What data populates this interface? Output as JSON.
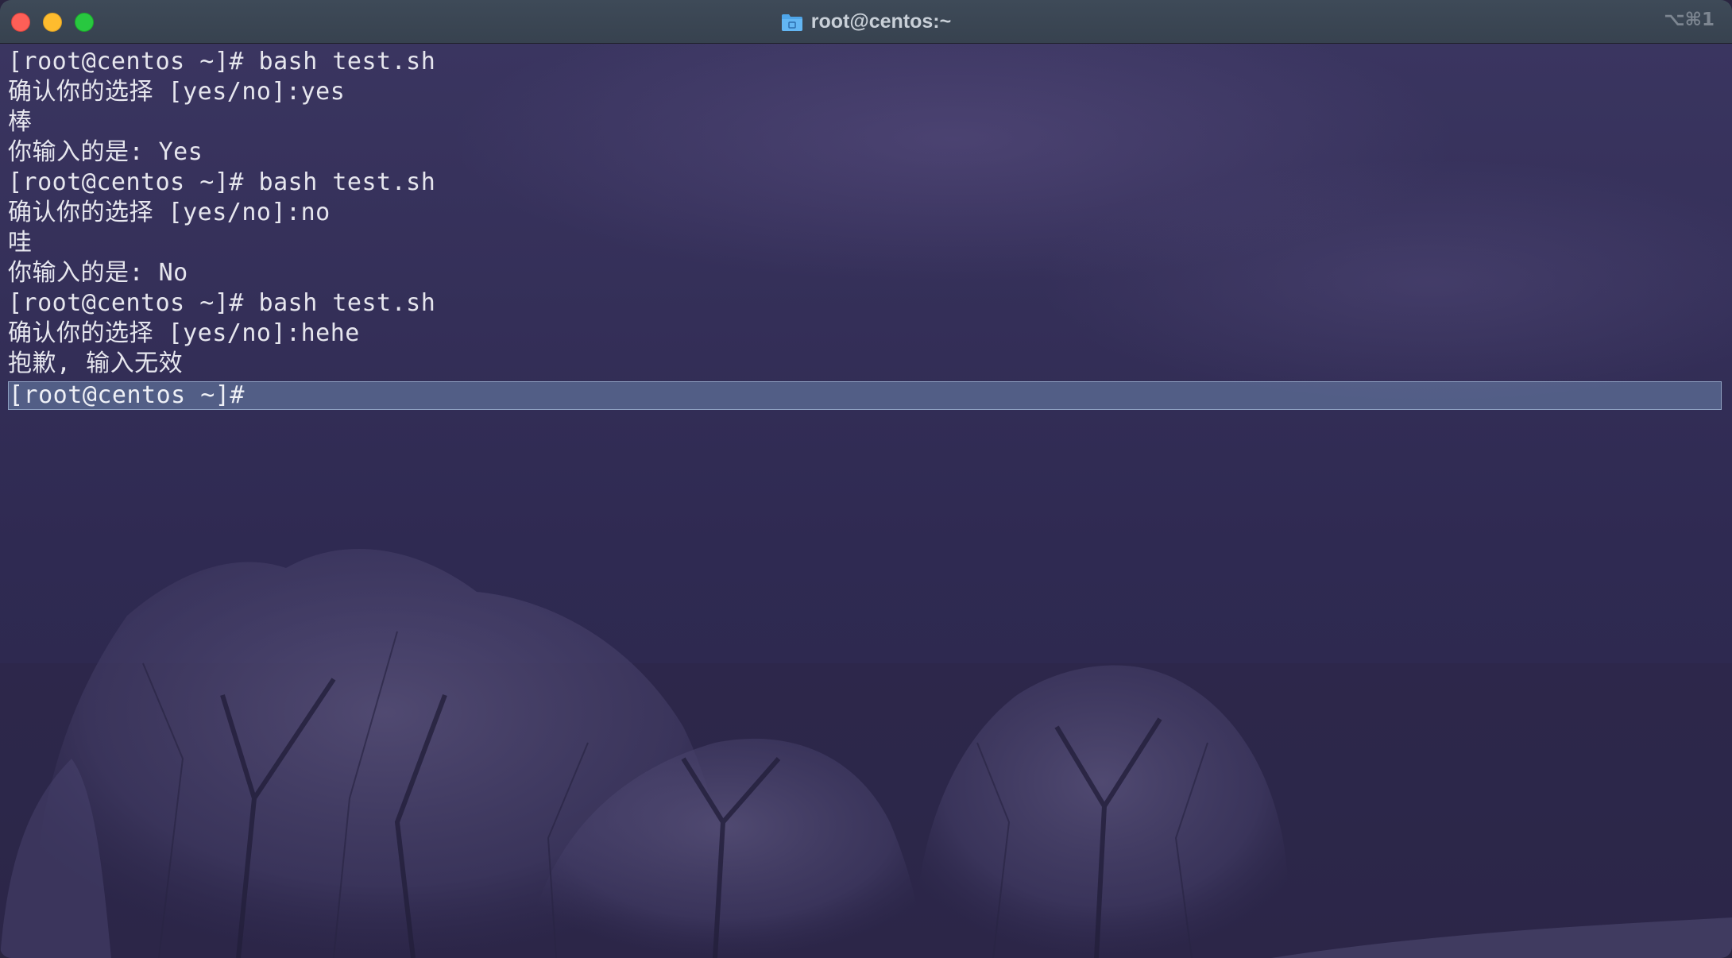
{
  "window": {
    "title": "root@centos:~",
    "shortcut": "⌥⌘1"
  },
  "icons": {
    "title": "folder-icon",
    "traffic": [
      "close-icon",
      "minimize-icon",
      "maximize-icon"
    ]
  },
  "colors": {
    "close": "#fe5f57",
    "minimize": "#febc2e",
    "maximize": "#28c840",
    "highlight": "#4f5e86"
  },
  "terminal": {
    "lines": [
      "[root@centos ~]# bash test.sh",
      "确认你的选择 [yes/no]:yes",
      "棒",
      "你输入的是: Yes",
      "[root@centos ~]# bash test.sh",
      "确认你的选择 [yes/no]:no",
      "哇",
      "你输入的是: No",
      "[root@centos ~]# bash test.sh",
      "确认你的选择 [yes/no]:hehe",
      "抱歉, 输入无效"
    ],
    "current_prompt": "[root@centos ~]#"
  }
}
